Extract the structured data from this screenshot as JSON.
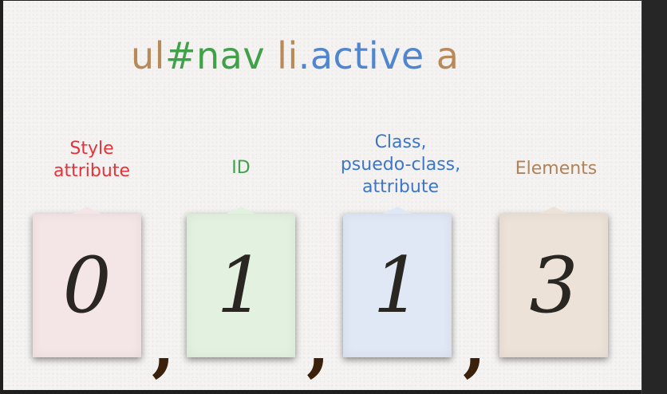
{
  "selector": {
    "part1": "ul",
    "part2": "#nav",
    "part3": " li",
    "part4": ".active",
    "part5": " a",
    "colors": {
      "element": "#b88a5a",
      "id": "#3fa24a",
      "class": "#4f86cf"
    }
  },
  "columns": [
    {
      "label": "Style\nattribute",
      "digit": "0",
      "label_color": "#e8313a",
      "card_color": "#f4e6e6"
    },
    {
      "label": "ID",
      "digit": "1",
      "label_color": "#3fa24a",
      "card_color": "#e3f1e0"
    },
    {
      "label": "Class,\npsuedo-class,\nattribute",
      "digit": "1",
      "label_color": "#3d76c6",
      "card_color": "#dfe8f4"
    },
    {
      "label": "Elements",
      "digit": "3",
      "label_color": "#b0825a",
      "card_color": "#ece2d8"
    }
  ],
  "separator": ","
}
